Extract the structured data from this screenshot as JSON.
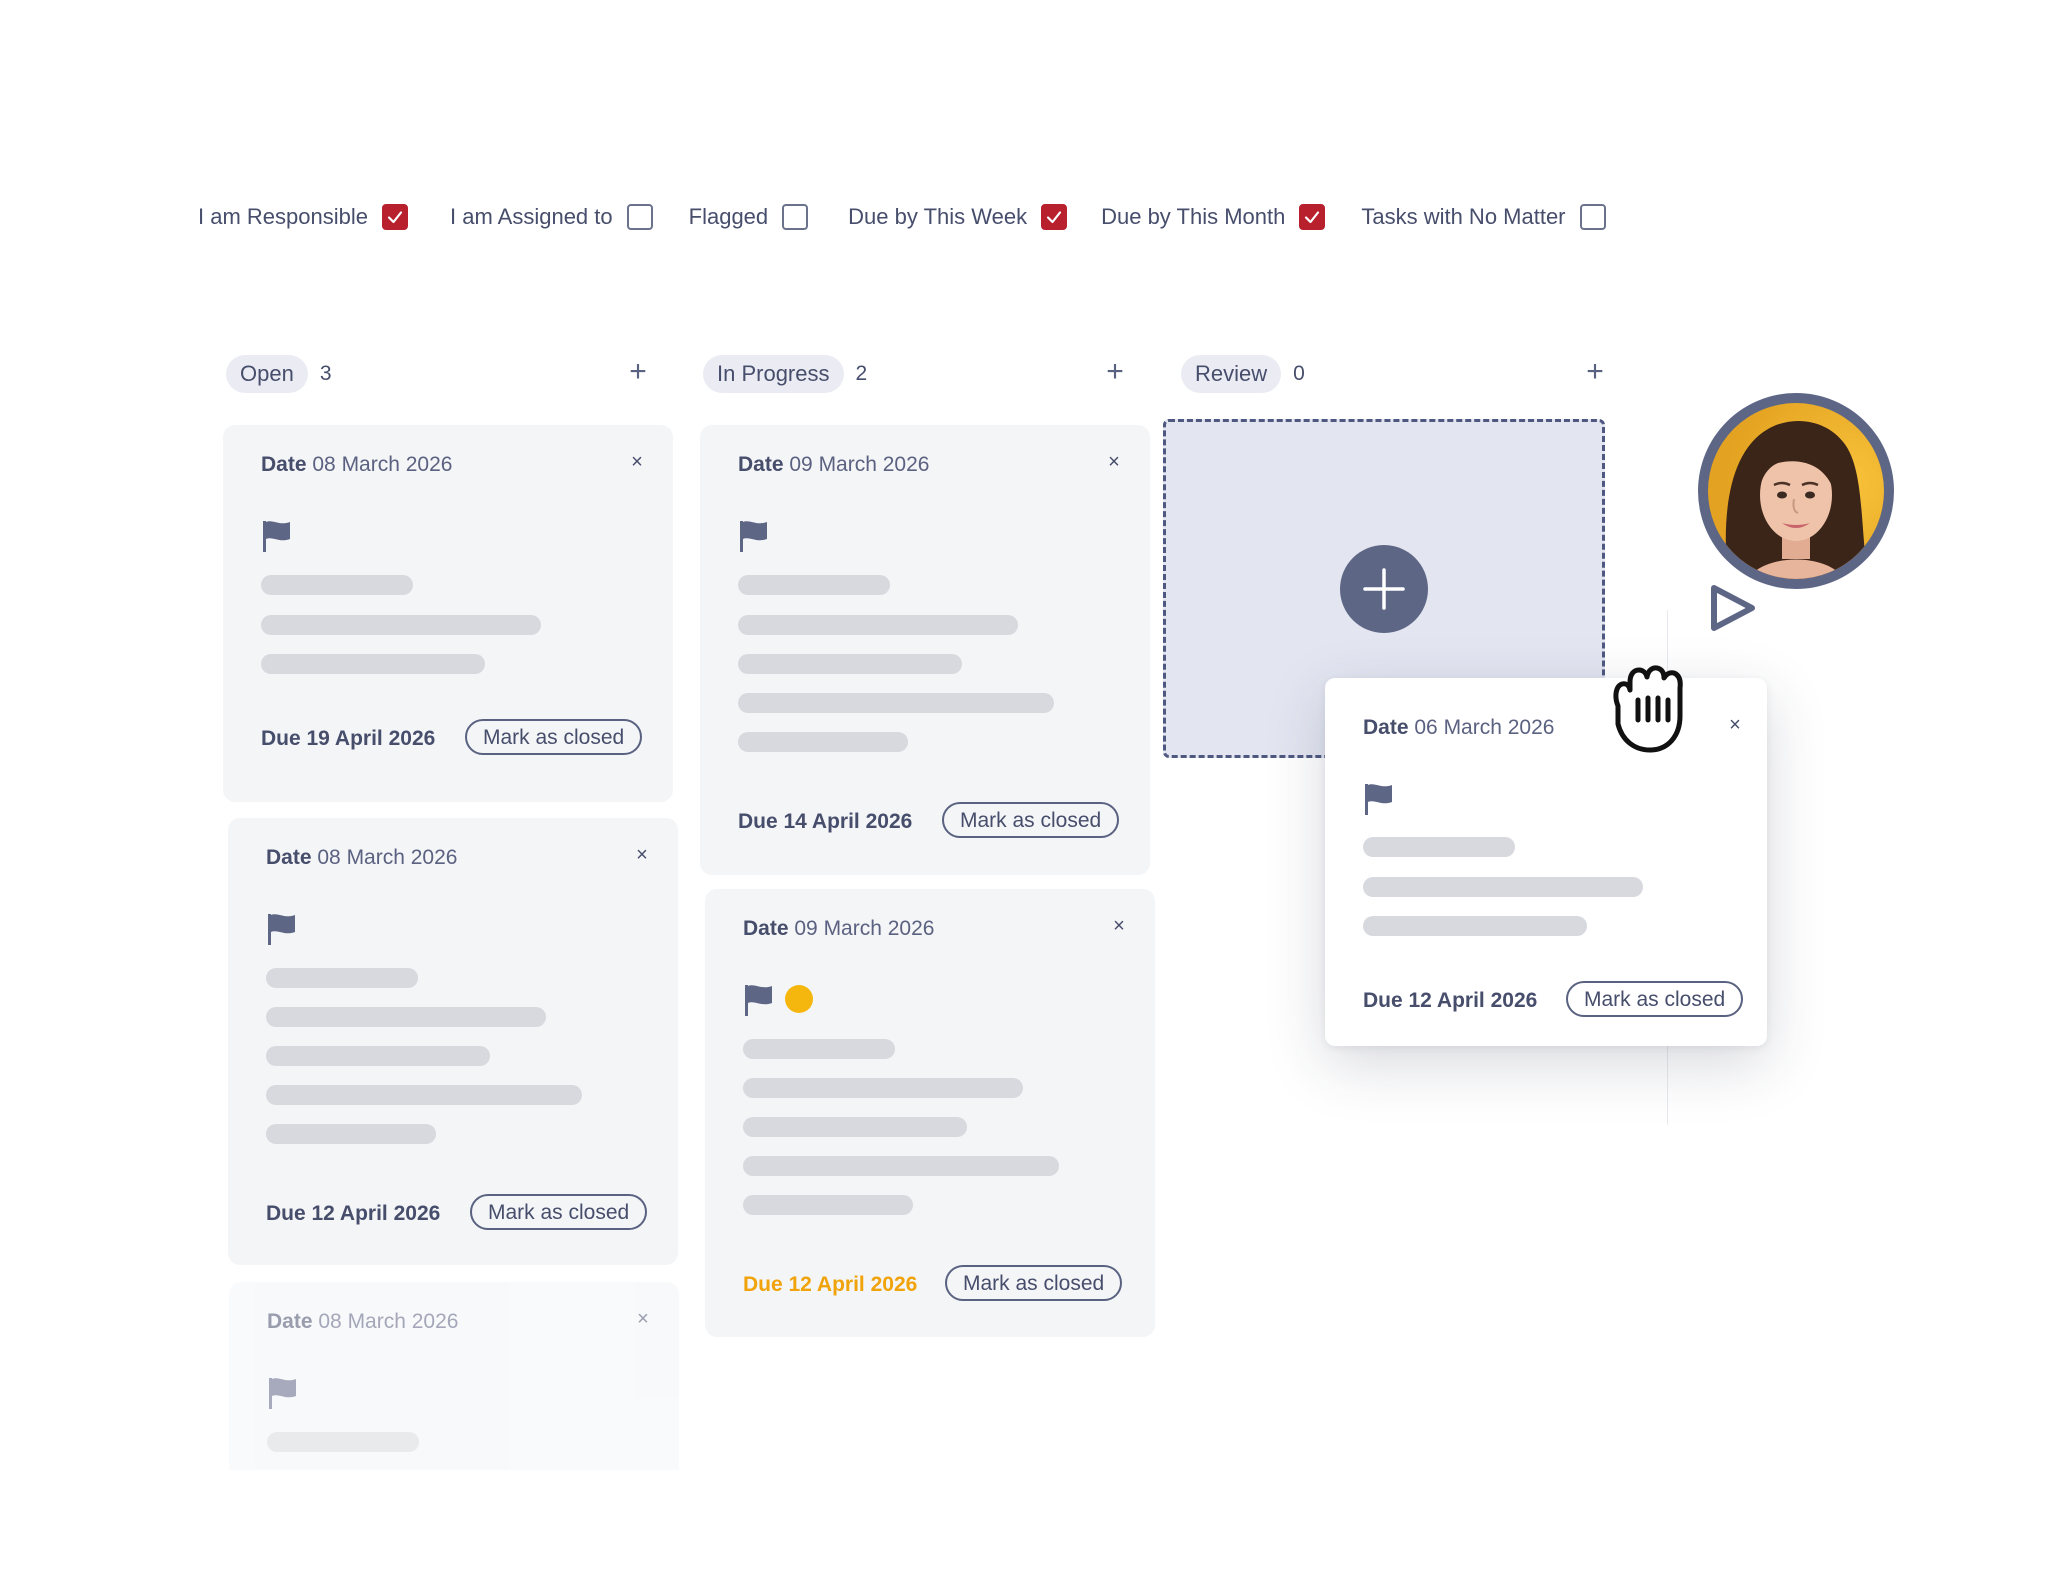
{
  "filters": [
    {
      "label": "I am Responsible",
      "checked": true
    },
    {
      "label": "I am Assigned to",
      "checked": false
    },
    {
      "label": "Flagged",
      "checked": false
    },
    {
      "label": "Due by This Week",
      "checked": true
    },
    {
      "label": "Due by This Month",
      "checked": true
    },
    {
      "label": "Tasks with No Matter",
      "checked": false
    }
  ],
  "columns": [
    {
      "name": "Open",
      "count": "3",
      "add_label": "+"
    },
    {
      "name": "In Progress",
      "count": "2",
      "add_label": "+"
    },
    {
      "name": "Review",
      "count": "0",
      "add_label": "+"
    }
  ],
  "date_label": "Date",
  "close_label": "×",
  "mark_label": "Mark as closed",
  "cards": {
    "open_1": {
      "date": "08 March 2026",
      "due": "Due 19 April 2026"
    },
    "open_2": {
      "date": "08 March 2026",
      "due": "Due 12 April 2026"
    },
    "open_3": {
      "date": "08 March 2026"
    },
    "progress_1": {
      "date": "09 March 2026",
      "due": "Due 14 April 2026"
    },
    "progress_2": {
      "date": "09 March 2026",
      "due": "Due 12 April 2026"
    },
    "dragged": {
      "date": "06 March 2026",
      "due": "Due 12 April 2026"
    }
  },
  "colors": {
    "checkbox_checked": "#b8202e",
    "accent": "#5e6686",
    "due_warning": "#f0a30a",
    "status_dot": "#f5b70d",
    "dropzone_bg": "#e3e6f1"
  },
  "icons": [
    "checkmark-icon",
    "plus-icon",
    "close-icon",
    "flag-icon",
    "grab-hand-icon",
    "cursor-arrow-icon"
  ]
}
